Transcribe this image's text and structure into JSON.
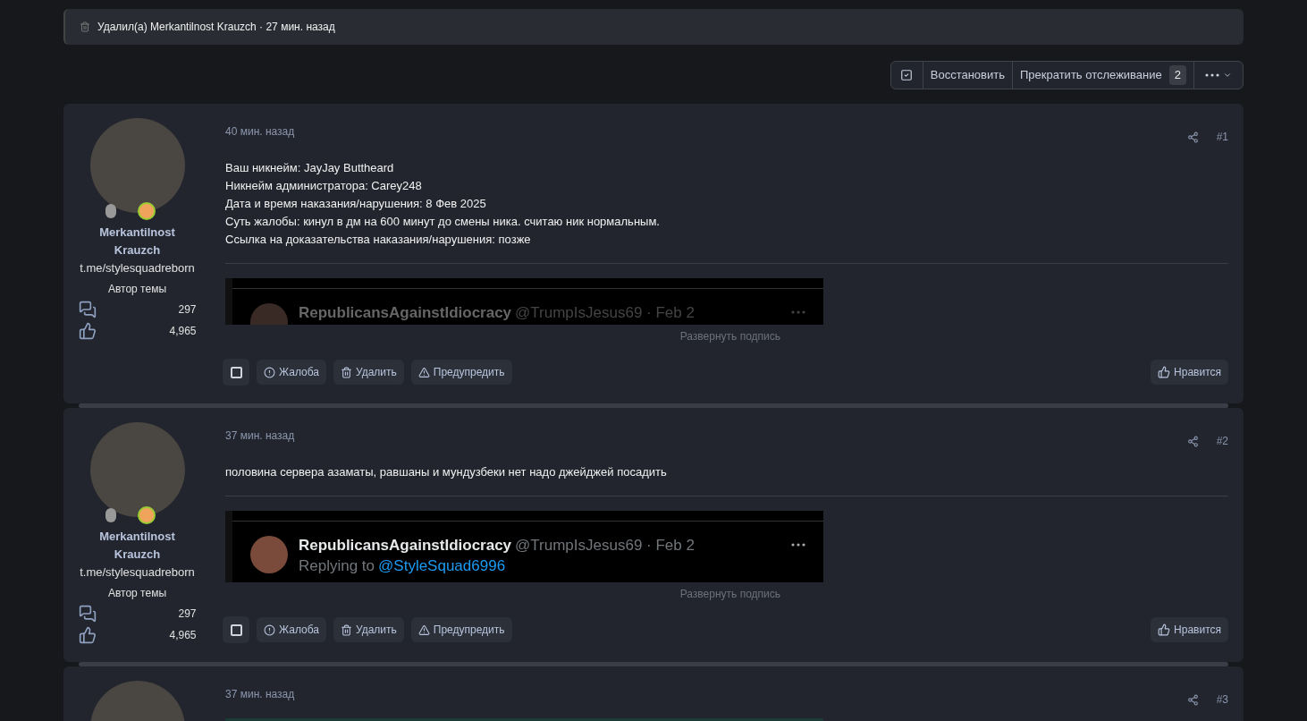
{
  "notice": {
    "text": "Удалил(а) Merkantilnost Krauzch · 27 мин. назад"
  },
  "toolbar": {
    "restore": "Восстановить",
    "unwatch": "Прекратить отслеживание",
    "unwatch_count": "2"
  },
  "posts": [
    {
      "selected": false,
      "author": "Merkantilnost Krauzch",
      "author_title": "t.me/stylesquadreborn",
      "badge": "Автор темы",
      "messages": "297",
      "reactions": "4,965",
      "time": "40 мин. назад",
      "number": "#1",
      "body": [
        "Ваш никнейм: JayJay Buttheard",
        "Никнейм администратора: Carey248",
        "Дата и время наказания/нарушения: 8 Фев 2025",
        "Суть жалобы: кинул в дм на 600 минут до смены ника. считаю ник нормальным.",
        "Ссылка на доказательства наказания/нарушения: позже"
      ],
      "signature": {
        "kind": "tweet",
        "faded": true,
        "name": "RepublicansAgainstIdiocracy",
        "handle": "@TrumpIsJesus69 · Feb 2"
      },
      "expand": "Развернуть подпись",
      "actions": [
        {
          "kind": "report",
          "label": "Жалоба"
        },
        {
          "kind": "delete",
          "label": "Удалить"
        },
        {
          "kind": "warn",
          "label": "Предупредить"
        }
      ],
      "like": "Нравится"
    },
    {
      "selected": false,
      "author": "Merkantilnost Krauzch",
      "author_title": "t.me/stylesquadreborn",
      "badge": "Автор темы",
      "messages": "297",
      "reactions": "4,965",
      "time": "37 мин. назад",
      "number": "#2",
      "body": [
        "половина сервера азаматы, равшаны и мундузбеки нет надо джейджей посадить"
      ],
      "signature": {
        "kind": "tweet",
        "faded": false,
        "name": "RepublicansAgainstIdiocracy",
        "handle": "@TrumpIsJesus69 · Feb 2",
        "reply_prefix": "Replying to",
        "reply_to": "@StyleSquad6996"
      },
      "expand": "Развернуть подпись",
      "actions": [
        {
          "kind": "report",
          "label": "Жалоба"
        },
        {
          "kind": "delete",
          "label": "Удалить"
        },
        {
          "kind": "warn",
          "label": "Предупредить"
        }
      ],
      "like": "Нравится"
    },
    {
      "time": "37 мин. назад",
      "number": "#3",
      "media": {
        "kind": "video-frame"
      }
    }
  ]
}
